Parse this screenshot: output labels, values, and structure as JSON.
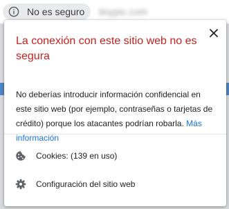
{
  "address_bar": {
    "security_chip_label": "No es seguro",
    "url": "tinypic.com"
  },
  "popup": {
    "title": "La conexión con este sitio web no es segura",
    "body": "No deberías introducir información confidencial en este sitio web (por ejemplo, contraseñas o tarjetas de crédito) porque los atacantes podrían robarla.",
    "more_info_link": "Más información",
    "cookies_label": "Cookies:",
    "cookies_count": "(139 en uso)",
    "site_settings_label": "Configuración del sitio web"
  },
  "colors": {
    "title_red": "#c5221f",
    "link_blue": "#1a73e8",
    "icon_grey": "#5f6368"
  },
  "icons": {
    "security": "info-icon",
    "close": "close-icon",
    "cookies": "cookie-icon",
    "settings": "gear-icon"
  }
}
